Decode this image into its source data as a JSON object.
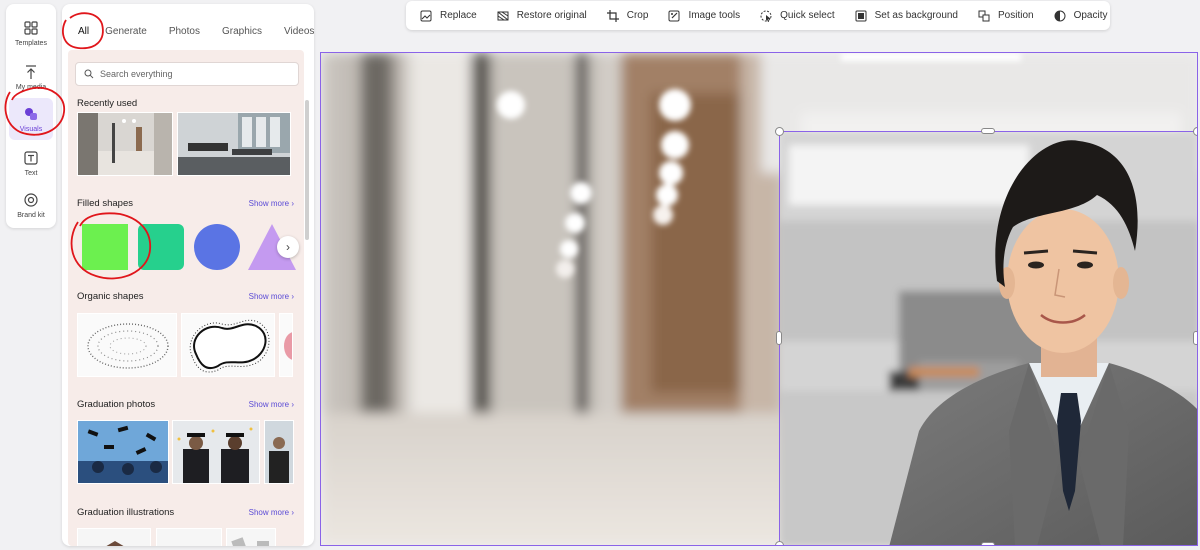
{
  "rail": {
    "items": [
      {
        "label": "Templates",
        "icon": "templates-icon"
      },
      {
        "label": "My media",
        "icon": "upload-icon"
      },
      {
        "label": "Visuals",
        "icon": "visuals-icon",
        "active": true
      },
      {
        "label": "Text",
        "icon": "text-icon"
      },
      {
        "label": "Brand kit",
        "icon": "brand-kit-icon"
      }
    ]
  },
  "panel": {
    "tabs": [
      "All",
      "Generate",
      "Photos",
      "Graphics",
      "Videos"
    ],
    "active_tab": "All",
    "search_placeholder": "Search everything",
    "sections": {
      "recently_used": "Recently used",
      "filled_shapes": "Filled shapes",
      "organic_shapes": "Organic shapes",
      "graduation_photos": "Graduation photos",
      "graduation_illustrations": "Graduation illustrations"
    },
    "show_more": "Show more",
    "shape_colors": {
      "square": "#6cf04f",
      "rounded": "#26d08d",
      "circle": "#5a74e4",
      "triangle": "#c49af0"
    }
  },
  "toolbar": {
    "items": [
      {
        "label": "Replace",
        "icon": "replace-icon"
      },
      {
        "label": "Restore original",
        "icon": "restore-icon"
      },
      {
        "label": "Crop",
        "icon": "crop-icon"
      },
      {
        "label": "Image tools",
        "icon": "image-tools-icon"
      },
      {
        "label": "Quick select",
        "icon": "quick-select-icon"
      },
      {
        "label": "Set as background",
        "icon": "set-background-icon"
      },
      {
        "label": "Position",
        "icon": "position-icon"
      },
      {
        "label": "Opacity",
        "icon": "opacity-icon"
      }
    ]
  },
  "colors": {
    "accent": "#8a63e8",
    "annotation": "#e0161b",
    "link": "#5b4bd6"
  }
}
